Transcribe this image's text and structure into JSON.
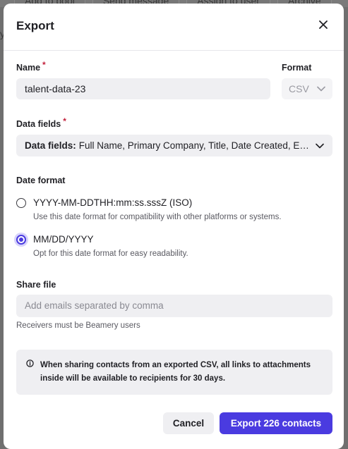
{
  "background": {
    "toolbar_buttons": [
      "Add to pool",
      "Send message",
      "Assign to user",
      "Archive"
    ],
    "side_text": "y"
  },
  "modal": {
    "title": "Export",
    "close_icon": "close-icon"
  },
  "name": {
    "label": "Name",
    "required_marker": "*",
    "value": "talent-data-23"
  },
  "format": {
    "label": "Format",
    "value": "CSV"
  },
  "data_fields": {
    "label": "Data fields",
    "required_marker": "*",
    "prefix": "Data fields:",
    "value": "Full Name, Primary Company, Title, Date Created, Email"
  },
  "date_format": {
    "label": "Date format",
    "options": [
      {
        "title": "YYYY-MM-DDTHH:mm:ss.sssZ (ISO)",
        "description": "Use this date format for compatibility with other platforms or systems.",
        "selected": false
      },
      {
        "title": "MM/DD/YYYY",
        "description": "Opt for this date format for easy readability.",
        "selected": true
      }
    ]
  },
  "share_file": {
    "label": "Share file",
    "placeholder": "Add emails separated by comma",
    "hint": "Receivers must be Beamery users"
  },
  "info": {
    "icon": "info-icon",
    "text": "When sharing contacts from an exported CSV, all links to attachments inside will be available to recipients for 30 days."
  },
  "footer": {
    "cancel_label": "Cancel",
    "export_label": "Export 226 contacts"
  },
  "colors": {
    "accent": "#4a3be0",
    "required": "#c21f3a",
    "field_bg": "#efeff2"
  }
}
